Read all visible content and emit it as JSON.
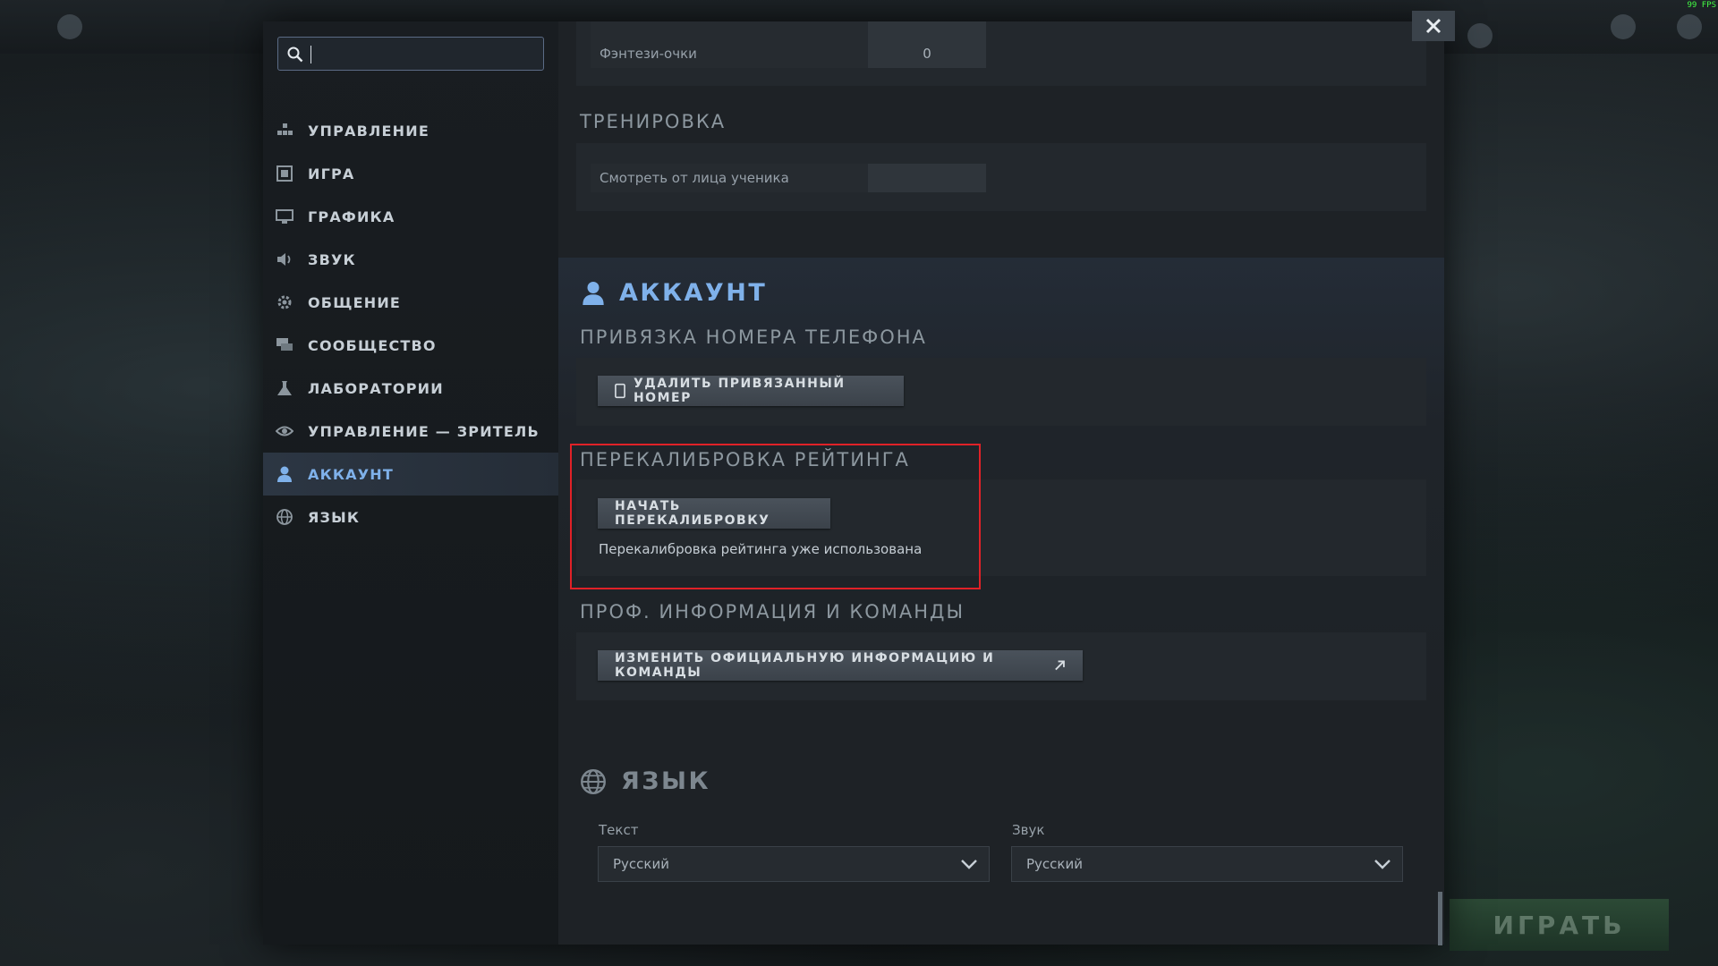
{
  "sidebar": {
    "search_placeholder": "",
    "items": [
      {
        "label": "УПРАВЛЕНИЕ",
        "icon": "controls-icon"
      },
      {
        "label": "ИГРА",
        "icon": "game-icon"
      },
      {
        "label": "ГРАФИКА",
        "icon": "monitor-icon"
      },
      {
        "label": "ЗВУК",
        "icon": "speaker-icon"
      },
      {
        "label": "ОБЩЕНИЕ",
        "icon": "gear-icon"
      },
      {
        "label": "СООБЩЕСТВО",
        "icon": "chat-icon"
      },
      {
        "label": "ЛАБОРАТОРИИ",
        "icon": "flask-icon"
      },
      {
        "label": "УПРАВЛЕНИЕ — ЗРИТЕЛЬ",
        "icon": "eye-icon"
      },
      {
        "label": "АККАУНТ",
        "icon": "user-icon",
        "active": true
      },
      {
        "label": "ЯЗЫК",
        "icon": "globe-icon"
      }
    ]
  },
  "game_section": {
    "fantasy_points_label": "Фэнтези-очки",
    "fantasy_points_value": "0"
  },
  "training": {
    "title": "ТРЕНИРОВКА",
    "watch_label": "Смотреть от лица ученика",
    "watch_value": ""
  },
  "account": {
    "title": "АККАУНТ",
    "phone": {
      "title": "ПРИВЯЗКА НОМЕРА ТЕЛЕФОНА",
      "button": "УДАЛИТЬ ПРИВЯЗАННЫЙ НОМЕР"
    },
    "recalibration": {
      "title": "ПЕРЕКАЛИБРОВКА РЕЙТИНГА",
      "button": "НАЧАТЬ ПЕРЕКАЛИБРОВКУ",
      "status": "Перекалибровка рейтинга уже использована"
    },
    "pro": {
      "title": "ПРОФ. ИНФОРМАЦИЯ И КОМАНДЫ",
      "button": "ИЗМЕНИТЬ ОФИЦИАЛЬНУЮ ИНФОРМАЦИЮ И КОМАНДЫ"
    }
  },
  "language": {
    "title": "ЯЗЫК",
    "text_label": "Текст",
    "text_value": "Русский",
    "audio_label": "Звук",
    "audio_value": "Русский"
  },
  "background": {
    "play_label": "ИГРАТЬ"
  },
  "colors": {
    "accent": "#7fb1ea",
    "highlight_box": "#e02127",
    "dialog_bg": "#1d2125"
  }
}
